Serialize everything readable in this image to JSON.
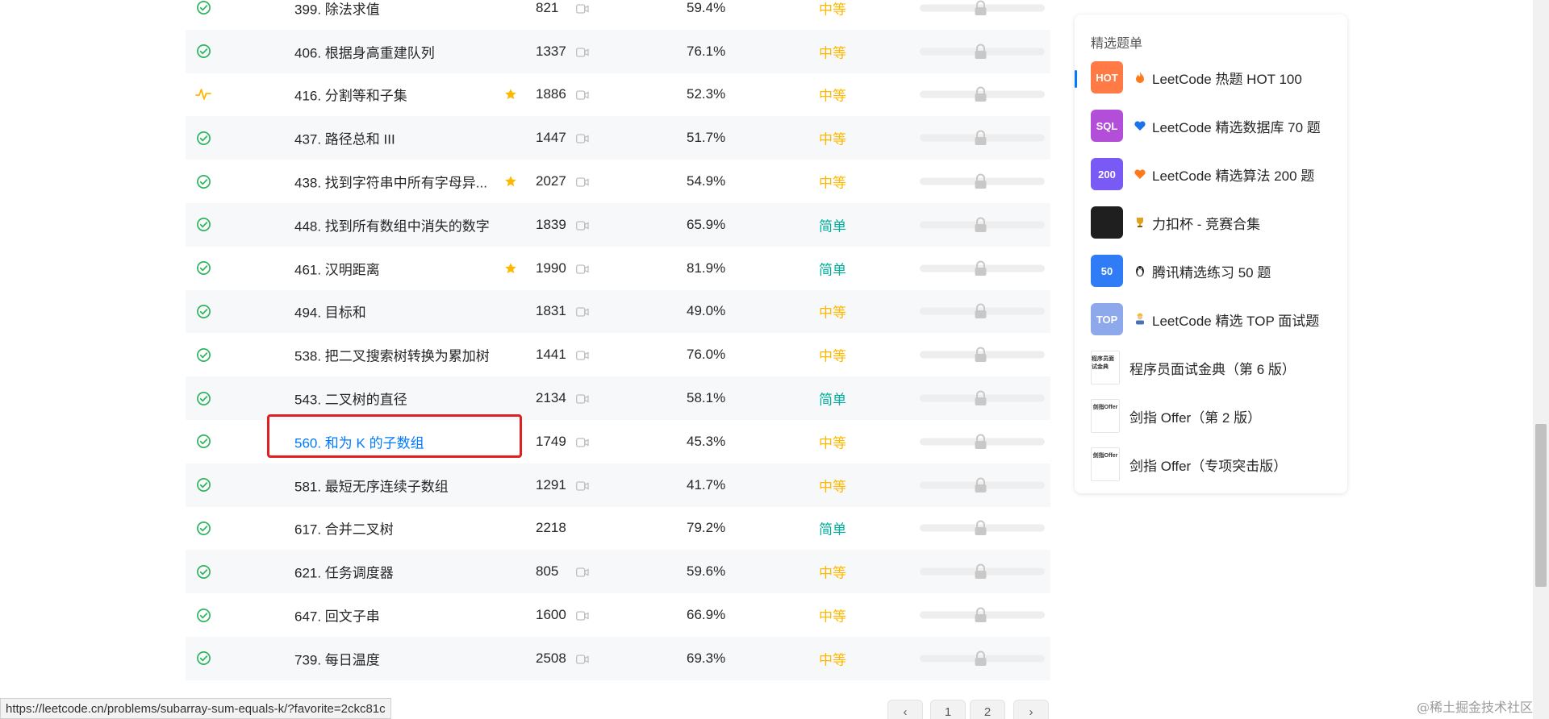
{
  "problems": [
    {
      "status": "solved",
      "title": "399. 除法求值",
      "starred": false,
      "solutions": "821",
      "video": true,
      "acceptance": "59.4%",
      "difficulty": "中等",
      "level": "medium"
    },
    {
      "status": "solved",
      "title": "406. 根据身高重建队列",
      "starred": false,
      "solutions": "1337",
      "video": true,
      "acceptance": "76.1%",
      "difficulty": "中等",
      "level": "medium"
    },
    {
      "status": "attempted",
      "title": "416. 分割等和子集",
      "starred": true,
      "solutions": "1886",
      "video": true,
      "acceptance": "52.3%",
      "difficulty": "中等",
      "level": "medium"
    },
    {
      "status": "solved",
      "title": "437. 路径总和 III",
      "starred": false,
      "solutions": "1447",
      "video": true,
      "acceptance": "51.7%",
      "difficulty": "中等",
      "level": "medium"
    },
    {
      "status": "solved",
      "title": "438. 找到字符串中所有字母异...",
      "starred": true,
      "solutions": "2027",
      "video": true,
      "acceptance": "54.9%",
      "difficulty": "中等",
      "level": "medium"
    },
    {
      "status": "solved",
      "title": "448. 找到所有数组中消失的数字",
      "starred": false,
      "solutions": "1839",
      "video": true,
      "acceptance": "65.9%",
      "difficulty": "简单",
      "level": "easy"
    },
    {
      "status": "solved",
      "title": "461. 汉明距离",
      "starred": true,
      "solutions": "1990",
      "video": true,
      "acceptance": "81.9%",
      "difficulty": "简单",
      "level": "easy"
    },
    {
      "status": "solved",
      "title": "494. 目标和",
      "starred": false,
      "solutions": "1831",
      "video": true,
      "acceptance": "49.0%",
      "difficulty": "中等",
      "level": "medium"
    },
    {
      "status": "solved",
      "title": "538. 把二叉搜索树转换为累加树",
      "starred": false,
      "solutions": "1441",
      "video": true,
      "acceptance": "76.0%",
      "difficulty": "中等",
      "level": "medium"
    },
    {
      "status": "solved",
      "title": "543. 二叉树的直径",
      "starred": false,
      "solutions": "2134",
      "video": true,
      "acceptance": "58.1%",
      "difficulty": "简单",
      "level": "easy"
    },
    {
      "status": "solved",
      "title": "560. 和为 K 的子数组",
      "starred": false,
      "solutions": "1749",
      "video": true,
      "acceptance": "45.3%",
      "difficulty": "中等",
      "level": "medium",
      "hovered": true
    },
    {
      "status": "solved",
      "title": "581. 最短无序连续子数组",
      "starred": false,
      "solutions": "1291",
      "video": true,
      "acceptance": "41.7%",
      "difficulty": "中等",
      "level": "medium"
    },
    {
      "status": "solved",
      "title": "617. 合并二叉树",
      "starred": false,
      "solutions": "2218",
      "video": false,
      "acceptance": "79.2%",
      "difficulty": "简单",
      "level": "easy"
    },
    {
      "status": "solved",
      "title": "621. 任务调度器",
      "starred": false,
      "solutions": "805",
      "video": true,
      "acceptance": "59.6%",
      "difficulty": "中等",
      "level": "medium"
    },
    {
      "status": "solved",
      "title": "647. 回文子串",
      "starred": false,
      "solutions": "1600",
      "video": true,
      "acceptance": "66.9%",
      "difficulty": "中等",
      "level": "medium"
    },
    {
      "status": "solved",
      "title": "739. 每日温度",
      "starred": false,
      "solutions": "2508",
      "video": true,
      "acceptance": "69.3%",
      "difficulty": "中等",
      "level": "medium"
    }
  ],
  "side_panel": {
    "title": "精选题单",
    "items": [
      {
        "cover_text": "HOT",
        "cover_color": "#ff7a45",
        "emoji": "fire-icon",
        "label": "LeetCode 热题 HOT 100",
        "active": true
      },
      {
        "cover_text": "SQL",
        "cover_color": "#b34ed8",
        "emoji": "blue-heart-icon",
        "label": "LeetCode 精选数据库 70 题"
      },
      {
        "cover_text": "200",
        "cover_color": "#7a5af5",
        "emoji": "orange-heart-icon",
        "label": "LeetCode 精选算法 200 题"
      },
      {
        "cover_text": "",
        "cover_color": "#1f1f1f",
        "emoji": "trophy-icon",
        "label": "力扣杯 - 竞赛合集"
      },
      {
        "cover_text": "50",
        "cover_color": "#2f7cf6",
        "emoji": "penguin-icon",
        "label": "腾讯精选练习 50 题"
      },
      {
        "cover_text": "TOP",
        "cover_color": "#8ea8ec",
        "emoji": "worker-icon",
        "label": "LeetCode 精选 TOP 面试题"
      },
      {
        "cover_text": "程序员面试金典",
        "book": true,
        "label": "程序员面试金典（第 6 版）"
      },
      {
        "cover_text": "剑指Offer",
        "book": true,
        "label": "剑指 Offer（第 2 版）"
      },
      {
        "cover_text": "剑指Offer",
        "book": true,
        "label": "剑指 Offer（专项突击版）"
      }
    ]
  },
  "status_url": "https://leetcode.cn/problems/subarray-sum-equals-k/?favorite=2ckc81c",
  "pagination": [
    "‹",
    "1",
    "2",
    "›"
  ],
  "watermark": "@稀土掘金技术社区",
  "colors": {
    "medium": "#ffb800",
    "easy": "#00af9b",
    "solved": "#2db55d",
    "attempted": "#ffb800",
    "link": "#007aff"
  }
}
